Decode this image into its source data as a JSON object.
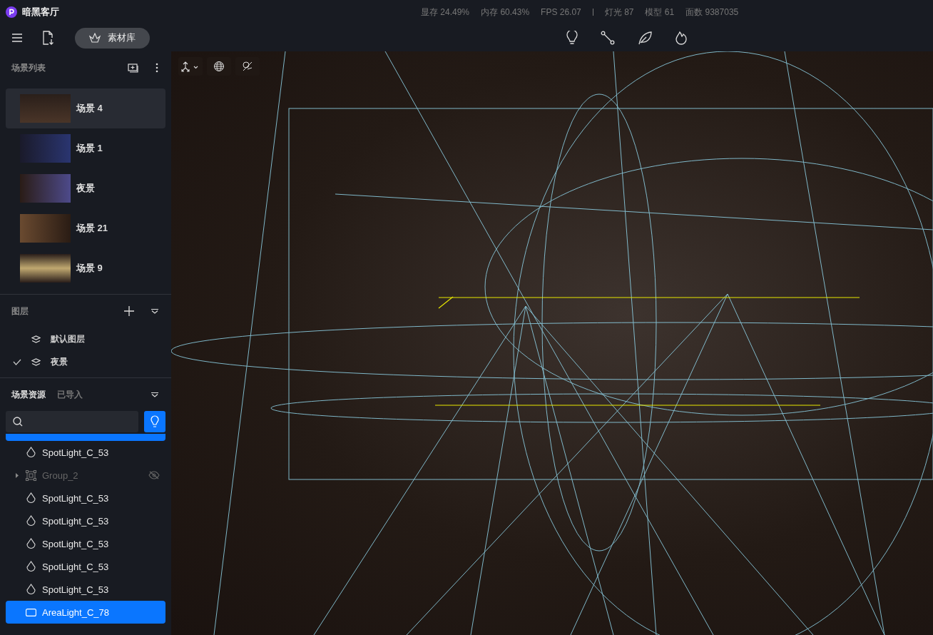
{
  "app": {
    "title": "暗黑客厅"
  },
  "stats": [
    "显存 24.49%",
    "内存 60.43%",
    "FPS 26.07",
    "灯光 87",
    "模型 61",
    "面数 9387035"
  ],
  "toolbar": {
    "library_button": "素材库"
  },
  "scene_list": {
    "title": "场景列表",
    "scenes": [
      {
        "name": "场景 4",
        "selected": true
      },
      {
        "name": "场景 1",
        "selected": false
      },
      {
        "name": "夜景",
        "selected": false
      },
      {
        "name": "场景 21",
        "selected": false
      },
      {
        "name": "场景 9",
        "selected": false
      }
    ]
  },
  "layers": {
    "title": "图层",
    "items": [
      {
        "name": "默认图层",
        "checked": false
      },
      {
        "name": "夜景",
        "checked": true
      }
    ]
  },
  "resources": {
    "tabs": [
      {
        "label": "场景资源",
        "selected": true
      },
      {
        "label": "已导入",
        "selected": false
      }
    ],
    "search": {
      "light_filter_on": true
    },
    "tree": [
      {
        "kind": "spot",
        "name": "SpotLight_C_53",
        "selected": false,
        "hidden": false
      },
      {
        "kind": "group",
        "name": "Group_2",
        "selected": false,
        "hidden": true
      },
      {
        "kind": "spot",
        "name": "SpotLight_C_53",
        "selected": false,
        "hidden": false
      },
      {
        "kind": "spot",
        "name": "SpotLight_C_53",
        "selected": false,
        "hidden": false
      },
      {
        "kind": "spot",
        "name": "SpotLight_C_53",
        "selected": false,
        "hidden": false
      },
      {
        "kind": "spot",
        "name": "SpotLight_C_53",
        "selected": false,
        "hidden": false
      },
      {
        "kind": "spot",
        "name": "SpotLight_C_53",
        "selected": false,
        "hidden": false
      },
      {
        "kind": "area",
        "name": "AreaLight_C_78",
        "selected": true,
        "hidden": false
      }
    ]
  }
}
